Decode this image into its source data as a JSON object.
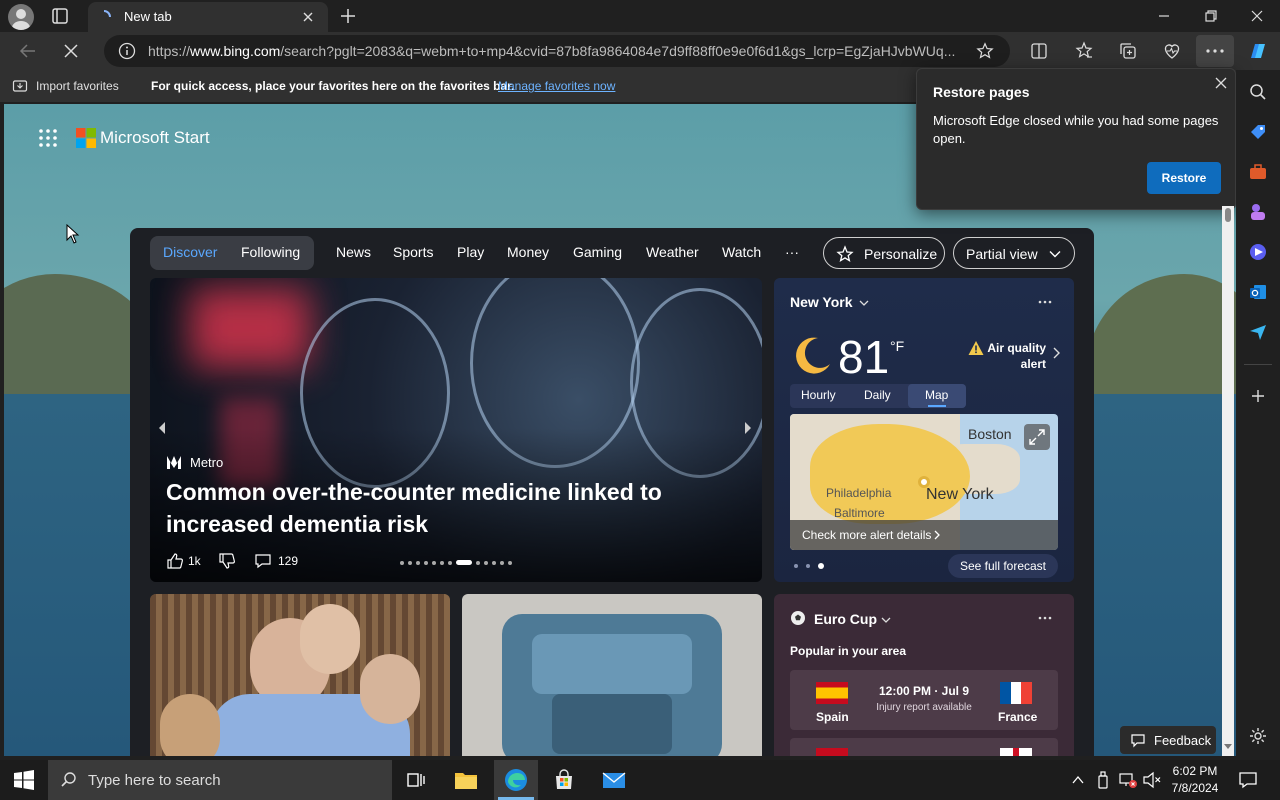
{
  "browser": {
    "tab_title": "New tab",
    "url_prefix": "https://",
    "url_host": "www.bing.com",
    "url_rest": "/search?pglt=2083&q=webm+to+mp4&cvid=87b8fa9864084e7d9ff88ff0e9e0f6d1&gs_lcrp=EgZjaHJvbWUq...",
    "favorites": {
      "import_label": "Import favorites",
      "message": "For quick access, place your favorites here on the favorites bar.",
      "manage_link": "Manage favorites now"
    }
  },
  "start": {
    "brand": "Microsoft Start",
    "nav": {
      "discover": "Discover",
      "following": "Following",
      "items": [
        "News",
        "Sports",
        "Play",
        "Money",
        "Gaming",
        "Weather",
        "Watch",
        "···"
      ],
      "personalize": "Personalize",
      "partial_view": "Partial view"
    },
    "hero": {
      "source": "Metro",
      "headline": "Common over-the-counter medicine linked to increased dementia risk",
      "likes": "1k",
      "comments": "129"
    },
    "weather": {
      "city": "New York",
      "temp": "81",
      "unit": "°F",
      "alert": "Air quality alert",
      "tabs": [
        "Hourly",
        "Daily",
        "Map"
      ],
      "map_labels": {
        "boston": "Boston",
        "philadelphia": "Philadelphia",
        "baltimore": "Baltimore",
        "newyork": "New York"
      },
      "map_footer": "Check more alert details",
      "forecast_button": "See full forecast"
    },
    "euro": {
      "title": "Euro Cup",
      "subtitle": "Popular in your area",
      "match": {
        "team1": "Spain",
        "team2": "France",
        "time": "12:00 PM · Jul 9",
        "note": "Injury report available"
      }
    }
  },
  "restore_popup": {
    "title": "Restore pages",
    "message": "Microsoft Edge closed while you had some pages open.",
    "button": "Restore"
  },
  "feedback": "Feedback",
  "taskbar": {
    "search_placeholder": "Type here to search",
    "time": "6:02 PM",
    "date": "7/8/2024"
  },
  "colors": {
    "accent": "#0f6cbd",
    "link": "#6db3ff",
    "discover_active": "#5aa8ff",
    "alert_yellow": "#f2c94c"
  }
}
